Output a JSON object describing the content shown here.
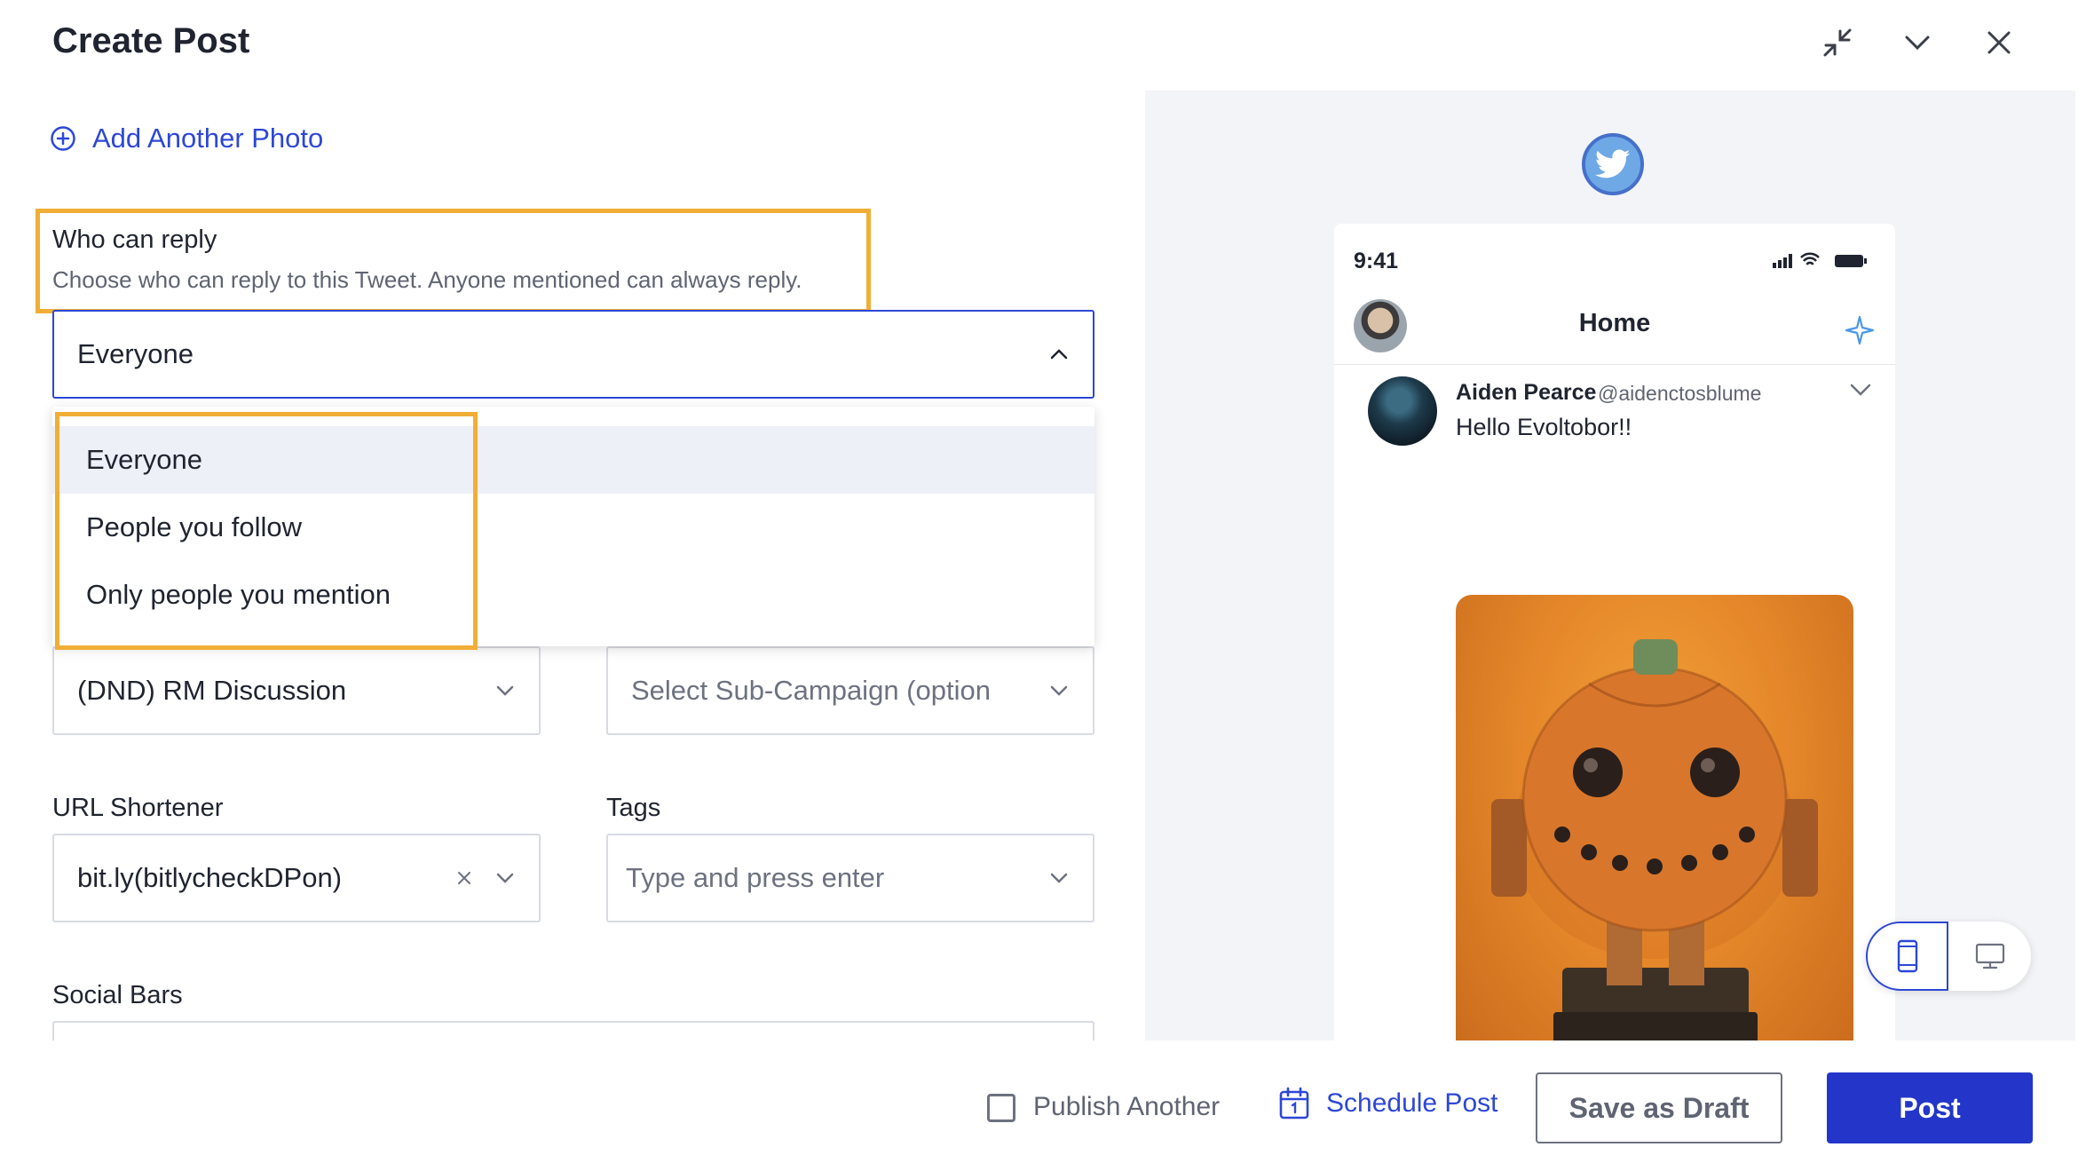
{
  "header": {
    "title": "Create Post",
    "icons": [
      "collapse-icon",
      "chevron-down-icon",
      "close-icon"
    ]
  },
  "left": {
    "add_photo_label": "Add Another Photo",
    "reply": {
      "label": "Who can reply",
      "description": "Choose who can reply to this Tweet. Anyone mentioned can always reply.",
      "selected": "Everyone",
      "options": [
        "Everyone",
        "People you follow",
        "Only people you mention"
      ]
    },
    "campaign": {
      "value": "(DND) RM Discussion"
    },
    "sub_campaign": {
      "placeholder": "Select Sub-Campaign (option"
    },
    "url_shortener": {
      "label": "URL Shortener",
      "value": "bit.ly(bitlycheckDPon)"
    },
    "tags": {
      "label": "Tags",
      "placeholder": "Type and press enter"
    },
    "social_bars": {
      "label": "Social Bars"
    }
  },
  "preview": {
    "network_icon": "twitter-icon",
    "status_time": "9:41",
    "home_title": "Home",
    "tweet": {
      "name": "Aiden Pearce",
      "handle": "@aidenctosblume",
      "text": "Hello Evoltobor!!"
    },
    "actions": [
      "reply-icon",
      "retweet-icon",
      "like-icon",
      "mail-icon"
    ],
    "view_modes": [
      "mobile-view-icon",
      "desktop-view-icon"
    ]
  },
  "footer": {
    "publish_another_label": "Publish Another",
    "schedule_label": "Schedule Post",
    "draft_label": "Save as Draft",
    "post_label": "Post"
  },
  "colors": {
    "accent": "#2d47d6",
    "highlight": "#f1ae36",
    "post_button": "#2336c9",
    "twitter": "#6ea9e6"
  }
}
